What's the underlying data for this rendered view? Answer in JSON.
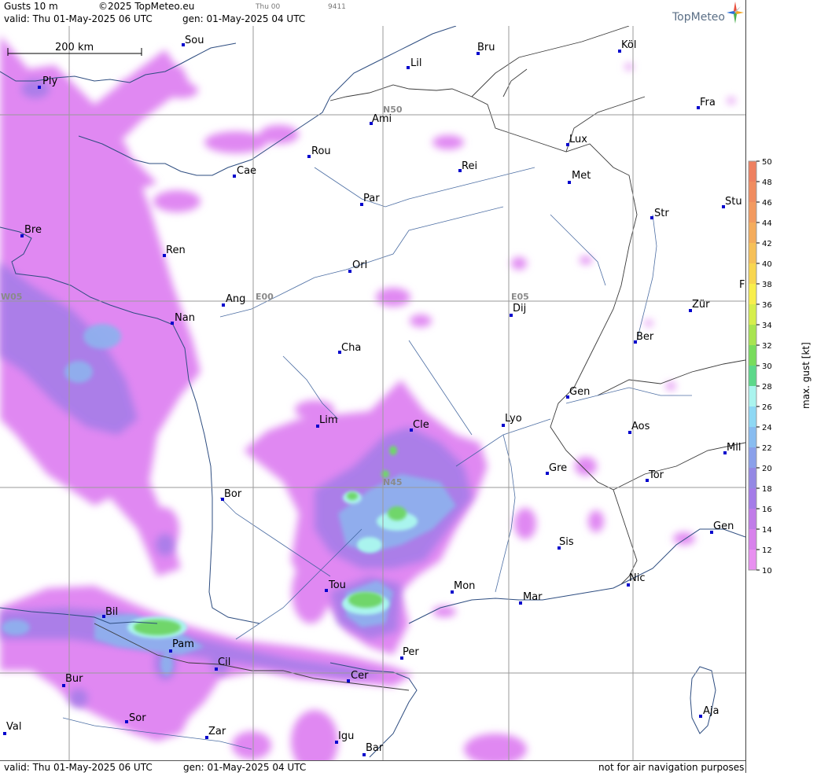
{
  "header": {
    "product": "Gusts 10 m",
    "copyright": "©2025 TopMeteo.eu",
    "valid": "valid:  Thu  01-May-2025  06 UTC",
    "generated": "gen:  01-May-2025 04 UTC",
    "run_code": "Thu 00",
    "id_code": "9411",
    "brand": "TopMeteo"
  },
  "footer": {
    "valid": "valid:  Thu  01-May-2025  06 UTC",
    "generated": "gen:  01-May-2025 04 UTC",
    "disclaimer": "not for air navigation purposes"
  },
  "map": {
    "scale_label": "200 km",
    "grid_labels": [
      "N50",
      "N45",
      "E00",
      "E05",
      "W05"
    ],
    "cities": [
      "Sou",
      "Bru",
      "Köl",
      "Lil",
      "Ply",
      "Fra",
      "Ami",
      "Lux",
      "Rou",
      "Cae",
      "Rei",
      "Met",
      "Par",
      "Stu",
      "Bre",
      "Str",
      "Ren",
      "Orl",
      "F",
      "Ang",
      "Dij",
      "Zür",
      "Nan",
      "Ber",
      "Cha",
      "Gen",
      "Lim",
      "Cle",
      "Lyo",
      "Aos",
      "Mil",
      "Gre",
      "Tor",
      "Bor",
      "Gen",
      "Sis",
      "Nic",
      "Tou",
      "Mon",
      "Mar",
      "Bil",
      "Pam",
      "Per",
      "Cil",
      "Cer",
      "Bur",
      "Sor",
      "Val",
      "Zar",
      "Aja",
      "Igu",
      "Bar"
    ]
  },
  "legend": {
    "title": "max. gust  [kt]",
    "ticks": [
      50,
      48,
      46,
      44,
      42,
      40,
      38,
      36,
      34,
      32,
      30,
      28,
      26,
      24,
      22,
      20,
      18,
      16,
      14,
      12,
      10
    ],
    "colors": {
      "50": "#ee8060",
      "48": "#f08c60",
      "46": "#f29a60",
      "44": "#f4ac5c",
      "42": "#f6c058",
      "40": "#f8d650",
      "38": "#f8ee4c",
      "36": "#d6ee4c",
      "34": "#a8e450",
      "32": "#78dc5c",
      "30": "#5cd88a",
      "28": "#aaf4ee",
      "26": "#8ed8f4",
      "24": "#88bcf0",
      "22": "#8aa0ea",
      "20": "#9488e4",
      "18": "#a47ce8",
      "16": "#c07ce8",
      "14": "#d882ec",
      "12": "#e890f0"
    }
  }
}
